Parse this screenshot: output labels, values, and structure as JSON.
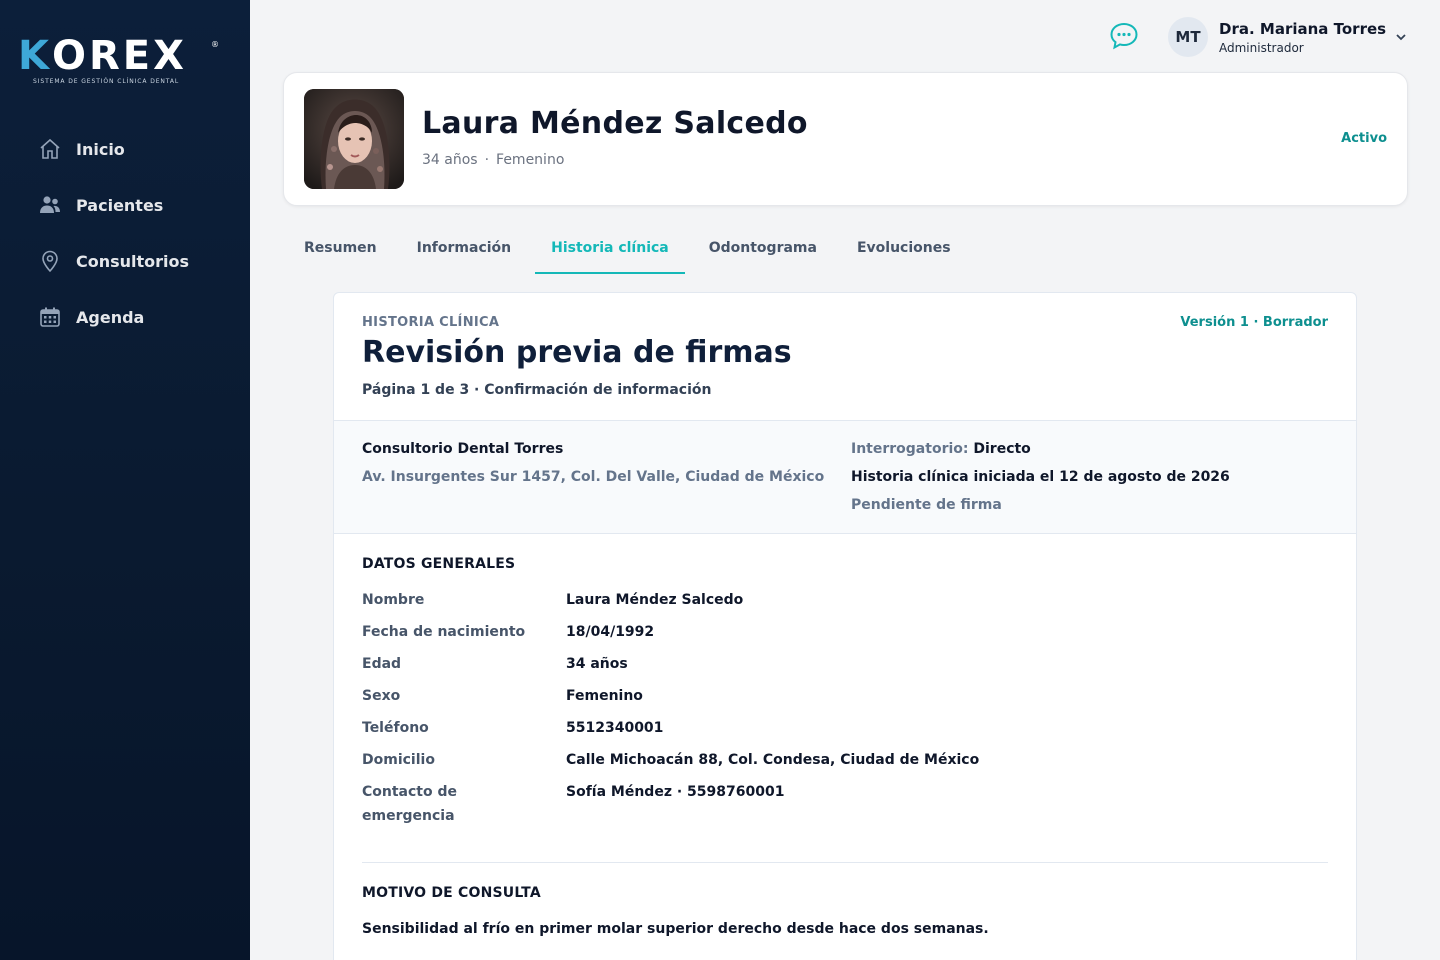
{
  "brand": {
    "name": "KOREX",
    "registered": "®",
    "tagline": "SISTEMA DE GESTIÓN CLÍNICA DENTAL"
  },
  "sidebar": {
    "items": [
      {
        "label": "Inicio",
        "icon": "home-icon"
      },
      {
        "label": "Pacientes",
        "icon": "users-icon"
      },
      {
        "label": "Consultorios",
        "icon": "location-pin-icon"
      },
      {
        "label": "Agenda",
        "icon": "calendar-icon"
      }
    ]
  },
  "header": {
    "chat_icon": "chat-bubble-icon",
    "user": {
      "initials": "MT",
      "name": "Dra. Mariana Torres",
      "role": "Administrador"
    }
  },
  "patient": {
    "name": "Laura Méndez Salcedo",
    "age": "34 años",
    "separator": "·",
    "sex": "Femenino",
    "status": "Activo"
  },
  "tabs": [
    {
      "label": "Resumen",
      "active": false
    },
    {
      "label": "Información",
      "active": false
    },
    {
      "label": "Historia clínica",
      "active": true
    },
    {
      "label": "Odontograma",
      "active": false
    },
    {
      "label": "Evoluciones",
      "active": false
    }
  ],
  "document": {
    "eyebrow": "HISTORIA CLÍNICA",
    "title": "Revisión previa de firmas",
    "subtitle": "Página 1 de 3 · Confirmación de información",
    "version": "Versión 1 · Borrador",
    "clinic": {
      "name": "Consultorio Dental Torres",
      "address": "Av. Insurgentes Sur 1457, Col. Del Valle, Ciudad de México",
      "interrogatorio_label": "Interrogatorio:",
      "interrogatorio_value": "Directo",
      "started": "Historia clínica iniciada el 12 de agosto de 2026",
      "pending": "Pendiente de firma"
    },
    "general": {
      "title": "DATOS GENERALES",
      "rows": [
        {
          "label": "Nombre",
          "value": "Laura Méndez Salcedo"
        },
        {
          "label": "Fecha de nacimiento",
          "value": "18/04/1992"
        },
        {
          "label": "Edad",
          "value": "34 años"
        },
        {
          "label": "Sexo",
          "value": "Femenino"
        },
        {
          "label": "Teléfono",
          "value": "5512340001"
        },
        {
          "label": "Domicilio",
          "value": "Calle Michoacán 88, Col. Condesa, Ciudad de México"
        },
        {
          "label": "Contacto de emergencia",
          "value": "Sofía Méndez · 5598760001"
        }
      ]
    },
    "motivo": {
      "title": "MOTIVO DE CONSULTA",
      "text": "Sensibilidad al frío en primer molar superior derecho desde hace dos semanas."
    }
  },
  "colors": {
    "accent": "#14b8b8",
    "accent_dark": "#0d8f8f",
    "sidebar_bg": "#0c1f3a",
    "logo_blue": "#3ea8d8"
  }
}
